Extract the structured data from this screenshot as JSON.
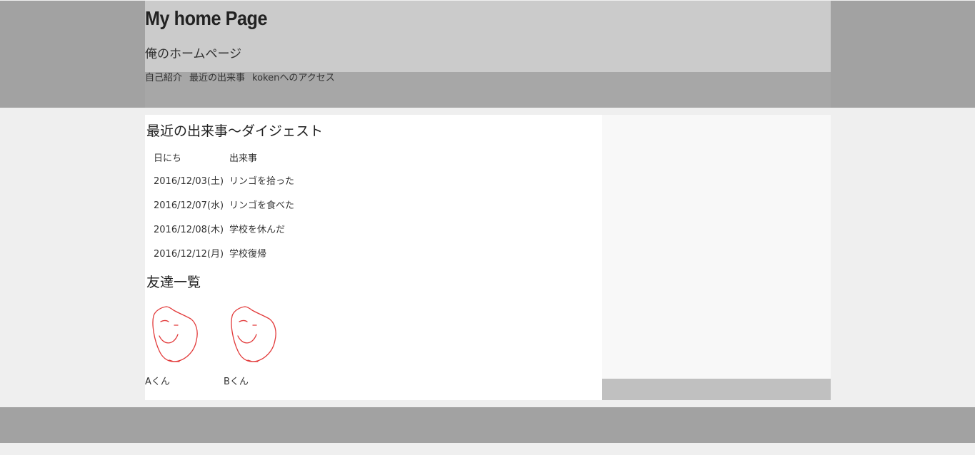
{
  "header": {
    "title": "My home Page",
    "subtitle": "俺のホームページ",
    "nav": [
      "自己紹介",
      "最近の出来事",
      "kokenへのアクセス"
    ]
  },
  "events": {
    "heading": "最近の出来事〜ダイジェスト",
    "columns": [
      "日にち",
      "出来事"
    ],
    "rows": [
      [
        "2016/12/03(土)",
        "リンゴを拾った"
      ],
      [
        "2016/12/07(水)",
        "リンゴを食べた"
      ],
      [
        "2016/12/08(木)",
        "学校を休んだ"
      ],
      [
        "2016/12/12(月)",
        "学校復帰"
      ]
    ]
  },
  "friends": {
    "heading": "友達一覧",
    "list": [
      {
        "name": "Aくん",
        "icon": "smiley-face-drawing"
      },
      {
        "name": "Bくん",
        "icon": "smiley-face-drawing"
      }
    ]
  },
  "colors": {
    "page_bg": "#efefef",
    "header_band": "#a2a2a2",
    "title_box": "#cbcbcb",
    "nav_box": "#a7a7a7",
    "main_bg": "#ffffff",
    "sidebar_bg": "#f8f8f8",
    "sidebar_footer": "#c0c0c0",
    "face_stroke": "#e23a3a"
  }
}
